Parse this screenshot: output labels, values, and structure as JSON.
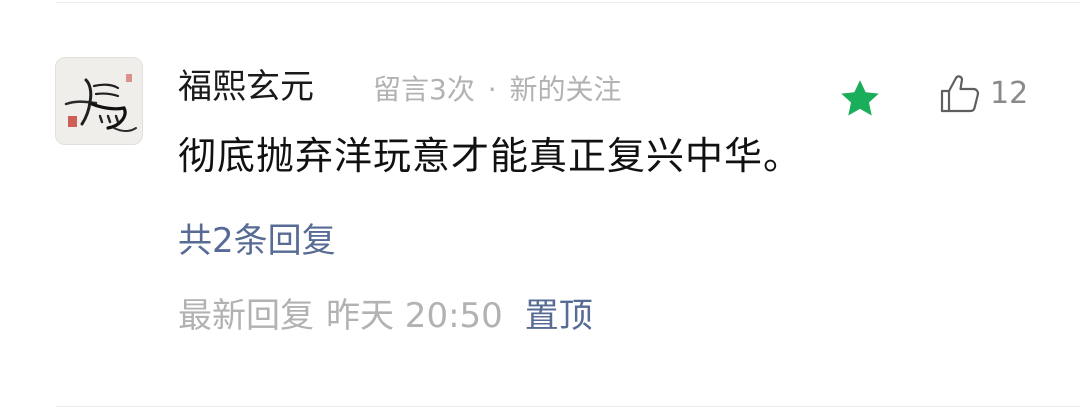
{
  "comment": {
    "username": "福熙玄元",
    "meta": {
      "message_count": "留言3次",
      "separator": "·",
      "follow_status": "新的关注"
    },
    "starred": true,
    "like_count": "12",
    "content": "彻底抛弃洋玩意才能真正复兴中华。",
    "replies_label": "共2条回复",
    "footer": {
      "latest_reply_label": "最新回复",
      "time": "昨天 20:50",
      "pin_label": "置顶"
    }
  },
  "colors": {
    "link": "#576b95",
    "star": "#1aad5a",
    "muted": "#b2b2b2",
    "text": "#111111"
  },
  "icons": {
    "star": "star-icon",
    "like": "thumbs-up-icon"
  }
}
